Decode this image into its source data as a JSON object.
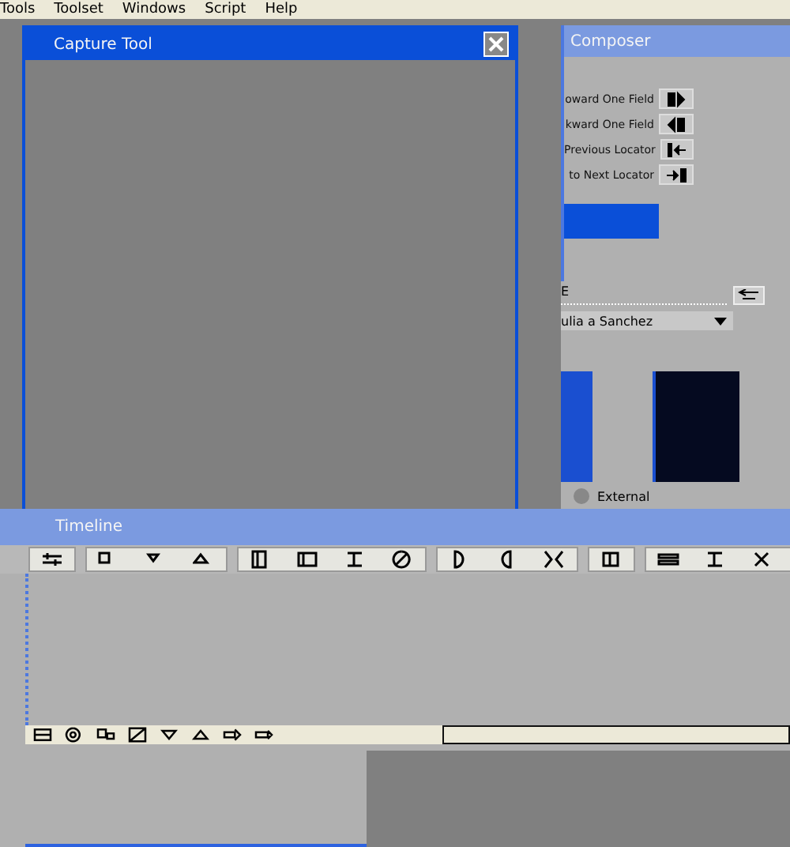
{
  "menu_bar": {
    "items": [
      "Tools",
      "Toolset",
      "Windows",
      "Script",
      "Help"
    ]
  },
  "capture_tool": {
    "title": "Capture Tool"
  },
  "composer": {
    "title": "Composer",
    "rows": [
      {
        "label": "oward One Field"
      },
      {
        "label": "kward One Field"
      },
      {
        "label": "Previous Locator"
      },
      {
        "label": "to Next Locator"
      }
    ],
    "field": {
      "value": "E"
    },
    "dropdown": {
      "value": "ulia a Sanchez"
    },
    "source_option": {
      "label": "External",
      "selected": false
    }
  },
  "timeline": {
    "title": "Timeline"
  }
}
